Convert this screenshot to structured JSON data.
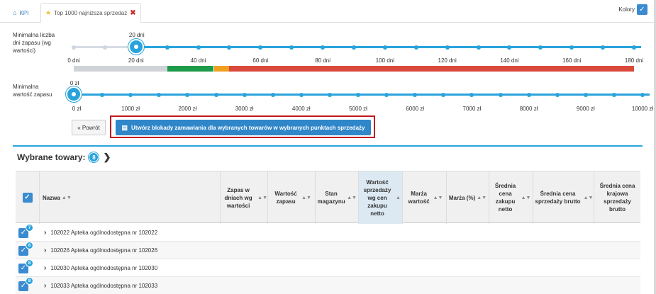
{
  "tabs": [
    {
      "icon": "home-icon",
      "label": "KPI"
    },
    {
      "icon": "star-icon",
      "label": "Top 1000 najniższa sprzedaż"
    }
  ],
  "colors_toggle": {
    "label": "Kolory",
    "checked": true
  },
  "slider_days": {
    "label": "Minimalna liczba dni zapasu (wg wartości)",
    "value_label": "20 dni",
    "value": 20,
    "min": 0,
    "max": 180,
    "ticks": [
      "0 dni",
      "20 dni",
      "40 dni",
      "60 dni",
      "80 dni",
      "100 dni",
      "120 dni",
      "140 dni",
      "160 dni",
      "180 dni"
    ]
  },
  "color_bar": [
    {
      "from": 0,
      "to": 30,
      "color": "#cfd3d8"
    },
    {
      "from": 30,
      "to": 45,
      "color": "#1e9b4a"
    },
    {
      "from": 45,
      "to": 50,
      "color": "#f0a020"
    },
    {
      "from": 50,
      "to": 180,
      "color": "#d9493c"
    }
  ],
  "slider_value": {
    "label": "Minimalna wartość zapasu",
    "value_label": "0 zł",
    "value": 0,
    "min": 0,
    "max": 10000,
    "ticks": [
      "0 zł",
      "1000 zł",
      "2000 zł",
      "3000 zł",
      "4000 zł",
      "5000 zł",
      "6000 zł",
      "7000 zł",
      "8000 zł",
      "9000 zł",
      "10000 zł"
    ]
  },
  "buttons": {
    "back": "« Powrót",
    "create": "Utwórz blokady zamawiania dla wybranych towarów w wybranych punktach sprzedaży"
  },
  "selected": {
    "title": "Wybrane towary:",
    "count": "8"
  },
  "table": {
    "columns": [
      "Nazwa",
      "Zapas w dniach wg wartości",
      "Wartość zapasu",
      "Stan magazynu",
      "Wartość sprzedaży wg cen zakupu netto",
      "Marża wartość",
      "Marża (%)",
      "Średnia cena zakupu netto",
      "Średnia cena sprzedaży brutto",
      "Średnia cena krajowa sprzedaży brutto"
    ],
    "rows": [
      {
        "badge": "7",
        "label": "102022 Apteka ogólnodostępna nr 102022"
      },
      {
        "badge": "8",
        "label": "102026 Apteka ogólnodostępna nr 102026"
      },
      {
        "badge": "8",
        "label": "102030 Apteka ogólnodostępna nr 102030"
      },
      {
        "badge": "8",
        "label": "102033 Apteka ogólnodostępna nr 102033"
      }
    ]
  }
}
